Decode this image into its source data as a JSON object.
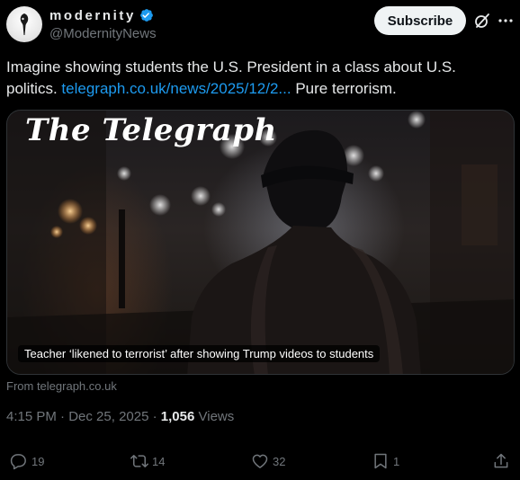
{
  "author": {
    "display_name": "modernity",
    "handle": "@ModernityNews",
    "avatar_icon": "bird-skull-icon",
    "verified": true,
    "verified_color": "#1d9bf0"
  },
  "header": {
    "subscribe_label": "Subscribe"
  },
  "tweet": {
    "text_before": "Imagine showing students the U.S. President in a class about U.S. politics. ",
    "link_text": "telegraph.co.uk/news/2025/12/2...",
    "text_after": " Pure terrorism.",
    "link_color": "#1d9bf0"
  },
  "card": {
    "logo_text": "The Telegraph",
    "caption": "Teacher ‘likened to terrorist’ after showing Trump videos to students",
    "source": "From telegraph.co.uk"
  },
  "meta": {
    "time": "4:15 PM",
    "separator": " · ",
    "date": "Dec 25, 2025",
    "views_count": "1,056",
    "views_label": " Views"
  },
  "actions": {
    "replies": "19",
    "reposts": "14",
    "likes": "32",
    "bookmarks": "1"
  }
}
